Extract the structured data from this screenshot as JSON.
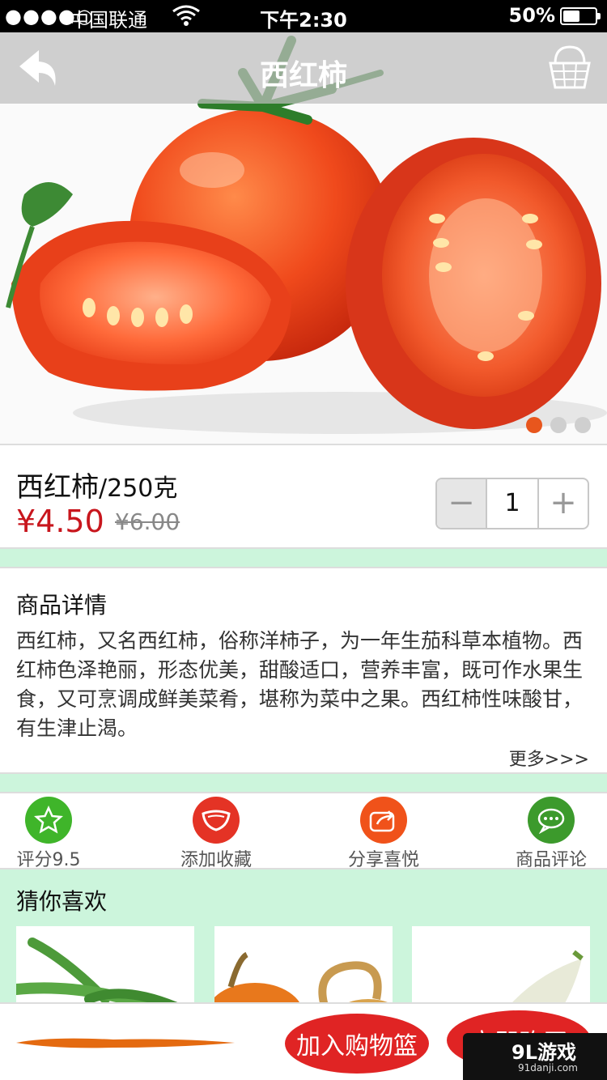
{
  "status_bar": {
    "signal": "●●●●○",
    "carrier": "中国联通",
    "time": "下午2:30",
    "battery": "50%",
    "battery_level": 0.5
  },
  "nav": {
    "title": "西红柿"
  },
  "carousel": {
    "pages": 3,
    "active_index": 0
  },
  "product": {
    "name": "西红柿",
    "unit": "/250克",
    "price": "¥4.50",
    "original_price": "¥6.00",
    "quantity": "1",
    "minus_label": "−",
    "plus_label": "+"
  },
  "details": {
    "title": "商品详情",
    "description": "西红柿，又名西红柿，俗称洋柿子，为一年生茄科草本植物。西红柿色泽艳丽，形态优美，甜酸适口，营养丰富，既可作水果生食，又可烹调成鲜美菜肴，堪称为菜中之果。西红柿性味酸甘，有生津止渴。",
    "more": "更多>>>"
  },
  "actions": [
    {
      "label": "评分9.5",
      "icon": "star-icon",
      "color": "#3fb52a"
    },
    {
      "label": "添加收藏",
      "icon": "favorite-icon",
      "color": "#e43325"
    },
    {
      "label": "分享喜悦",
      "icon": "share-icon",
      "color": "#f0521a"
    },
    {
      "label": "商品评论",
      "icon": "comment-icon",
      "color": "#3c9a2c"
    }
  ],
  "recommend": {
    "title": "猜你喜欢"
  },
  "bottom": {
    "add_to_basket": "加入购物篮",
    "buy_now": "立即购买"
  },
  "watermark": {
    "main": "9L游戏",
    "sub": "91danji.com"
  },
  "colors": {
    "accent_green": "#ccf5dc",
    "price_red": "#c8161d",
    "button_red": "#e02424",
    "active_dot": "#e8561d"
  }
}
